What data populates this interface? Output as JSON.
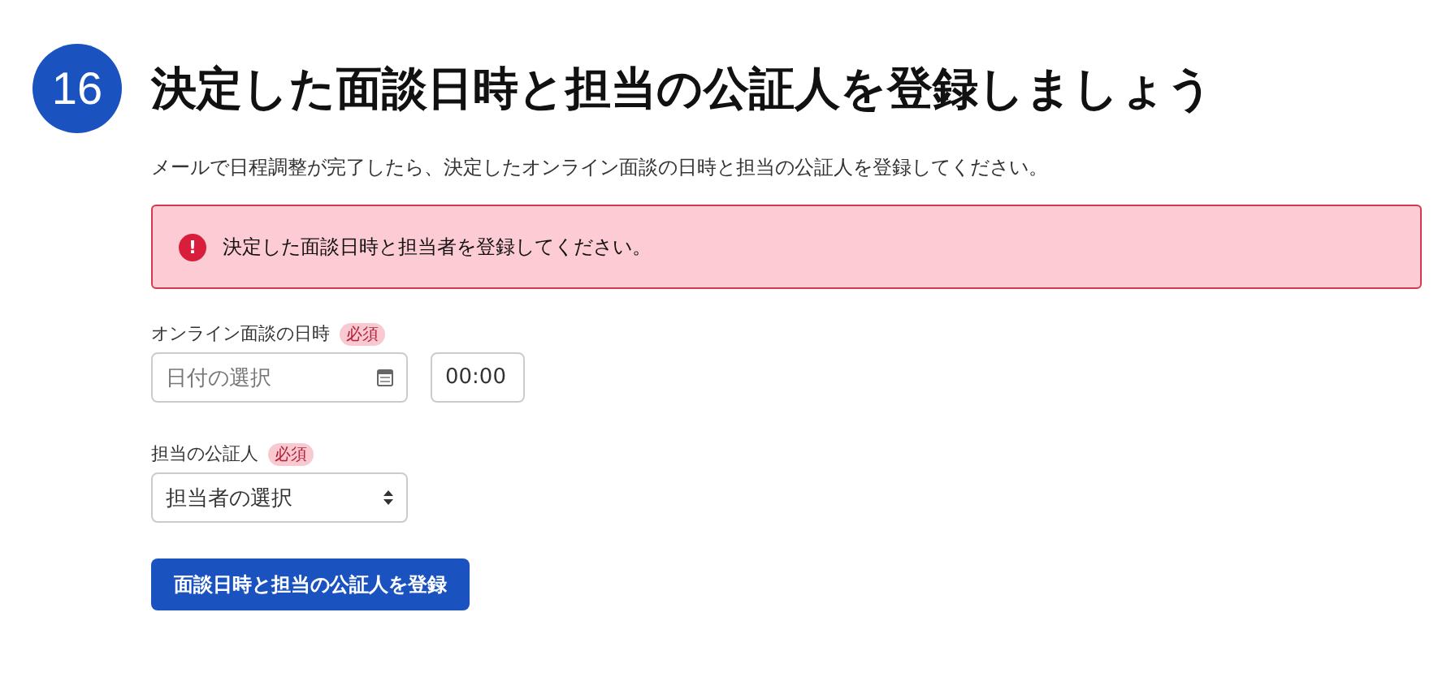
{
  "step": {
    "number": "16",
    "title": "決定した面談日時と担当の公証人を登録しましょう"
  },
  "description": "メールで日程調整が完了したら、決定したオンライン面談の日時と担当の公証人を登録してください。",
  "alert": {
    "icon": "!",
    "message": "決定した面談日時と担当者を登録してください。"
  },
  "fields": [
    {
      "kind": "datetime",
      "label": "オンライン面談の日時",
      "badge": "必須",
      "date_placeholder": "日付の選択",
      "time_value": "00:00"
    },
    {
      "kind": "select",
      "label": "担当の公証人",
      "badge": "必須",
      "placeholder": "担当者の選択"
    }
  ],
  "submit_button": "面談日時と担当の公証人を登録"
}
